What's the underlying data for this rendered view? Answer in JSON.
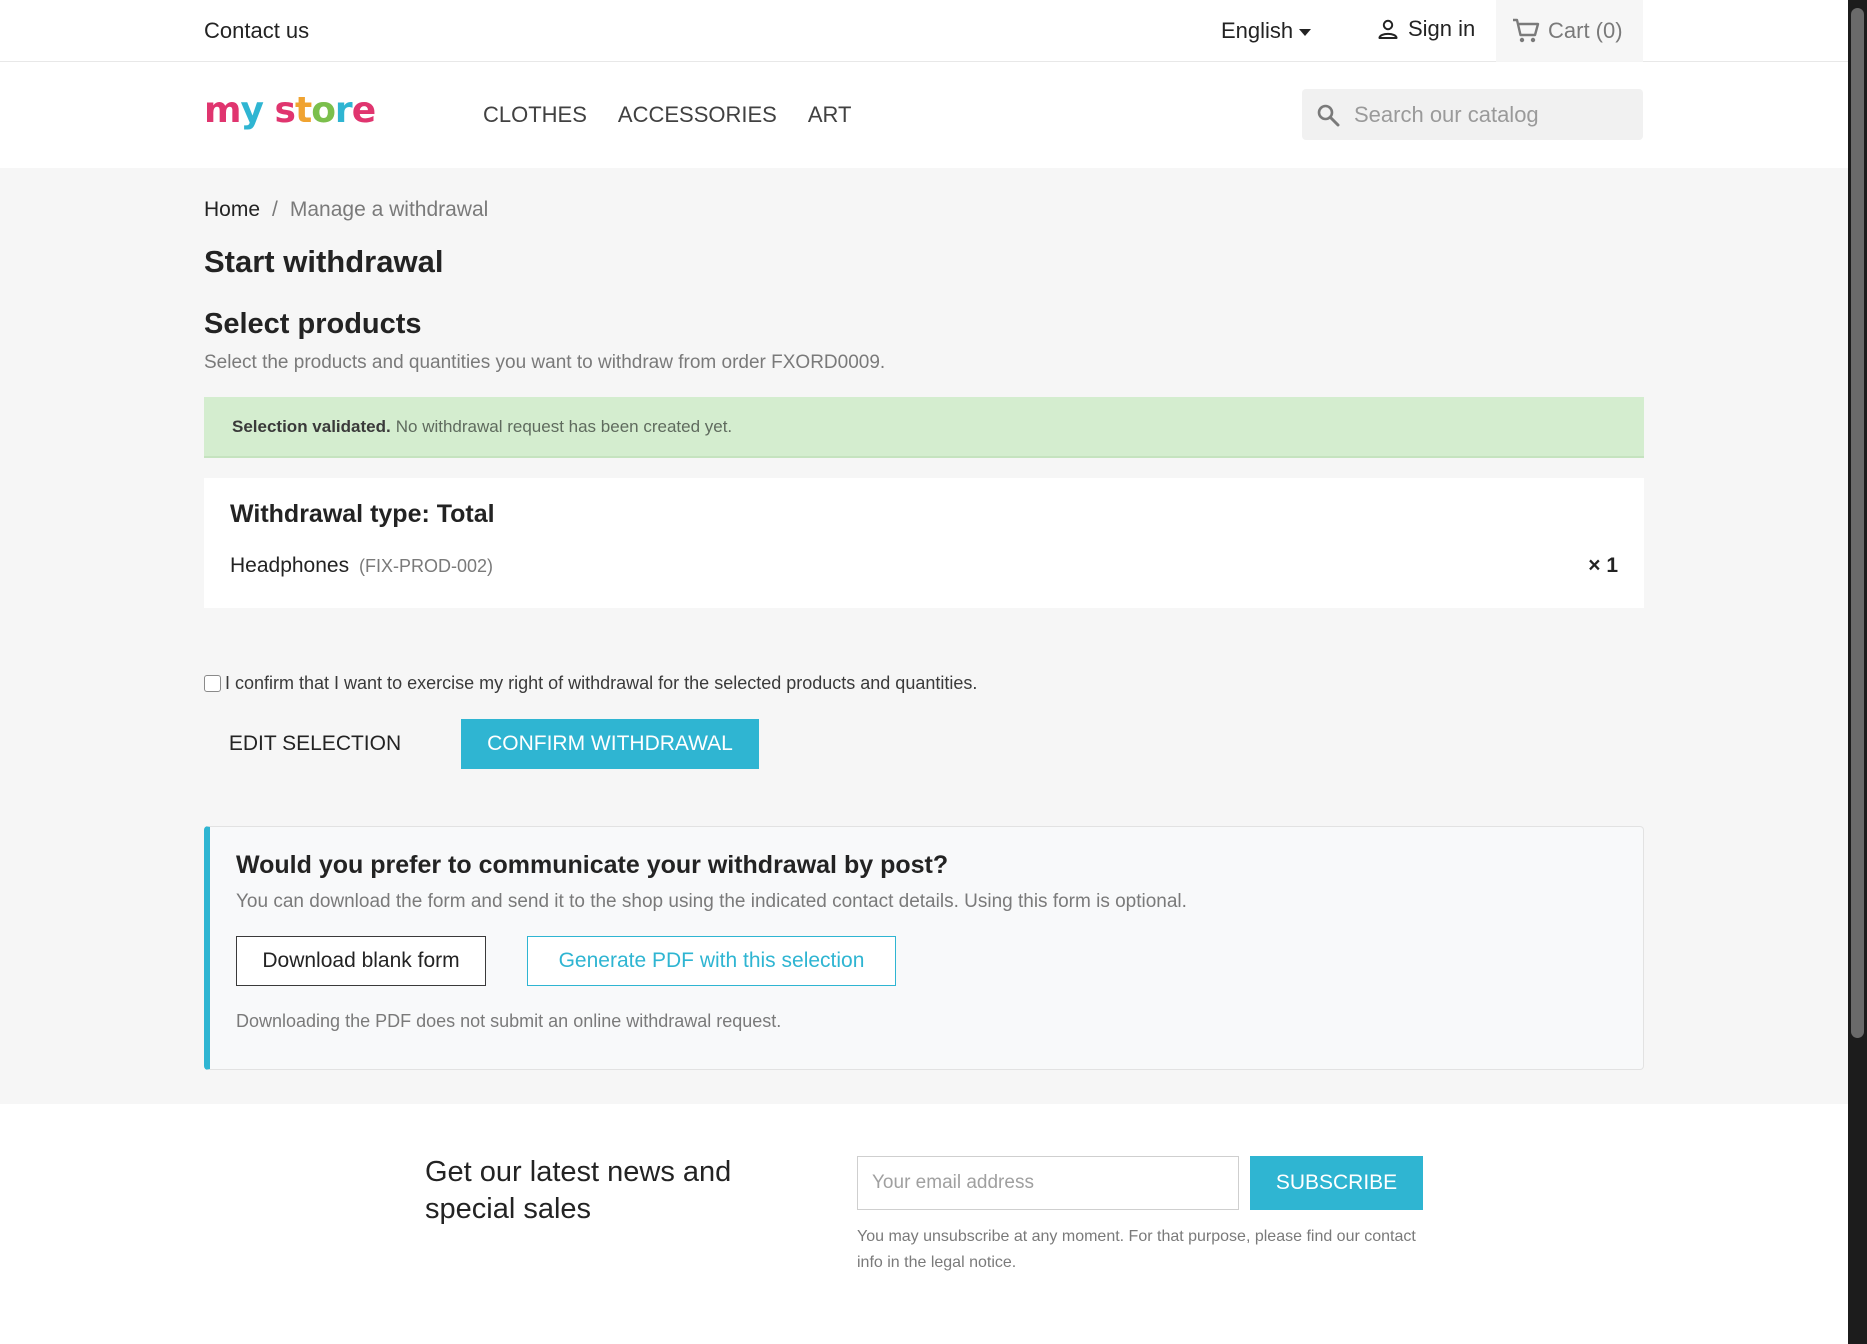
{
  "topbar": {
    "contact_label": "Contact us",
    "language": "English",
    "signin_label": "Sign in",
    "cart_label": "Cart (0)"
  },
  "header": {
    "logo": {
      "m": "m",
      "y": "y",
      "s": "s",
      "t": "t",
      "o": "o",
      "r": "r",
      "e": "e"
    },
    "menu": [
      "CLOTHES",
      "ACCESSORIES",
      "ART"
    ],
    "search_placeholder": "Search our catalog"
  },
  "breadcrumb": {
    "home": "Home",
    "separator": "/",
    "current": "Manage a withdrawal"
  },
  "page": {
    "title": "Start withdrawal",
    "section_title": "Select products",
    "section_subtitle": "Select the products and quantities you want to withdraw from order FXORD0009."
  },
  "alert": {
    "strong": "Selection validated.",
    "text": "No withdrawal request has been created yet."
  },
  "summary": {
    "title": "Withdrawal type: Total",
    "product_name": "Headphones",
    "product_ref": "(FIX-PROD-002)",
    "quantity": "× 1"
  },
  "confirm_text": "I confirm that I want to exercise my right of withdrawal for the selected products and quantities.",
  "actions": {
    "edit": "EDIT SELECTION",
    "confirm": "CONFIRM WITHDRAWAL"
  },
  "post": {
    "title": "Would you prefer to communicate your withdrawal by post?",
    "description": "You can download the form and send it to the shop using the indicated contact details. Using this form is optional.",
    "download_label": "Download blank form",
    "generate_label": "Generate PDF with this selection",
    "note": "Downloading the PDF does not submit an online withdrawal request."
  },
  "newsletter": {
    "title": "Get our latest news and special sales",
    "email_placeholder": "Your email address",
    "subscribe_label": "SUBSCRIBE",
    "note": "You may unsubscribe at any moment. For that purpose, please find our contact info in the legal notice."
  },
  "colors": {
    "accent": "#2fb5d2",
    "alert_bg": "#d4edcf",
    "page_bg": "#f6f6f6"
  },
  "icons": [
    "person-icon",
    "cart-icon",
    "search-icon",
    "caret-down-icon"
  ]
}
